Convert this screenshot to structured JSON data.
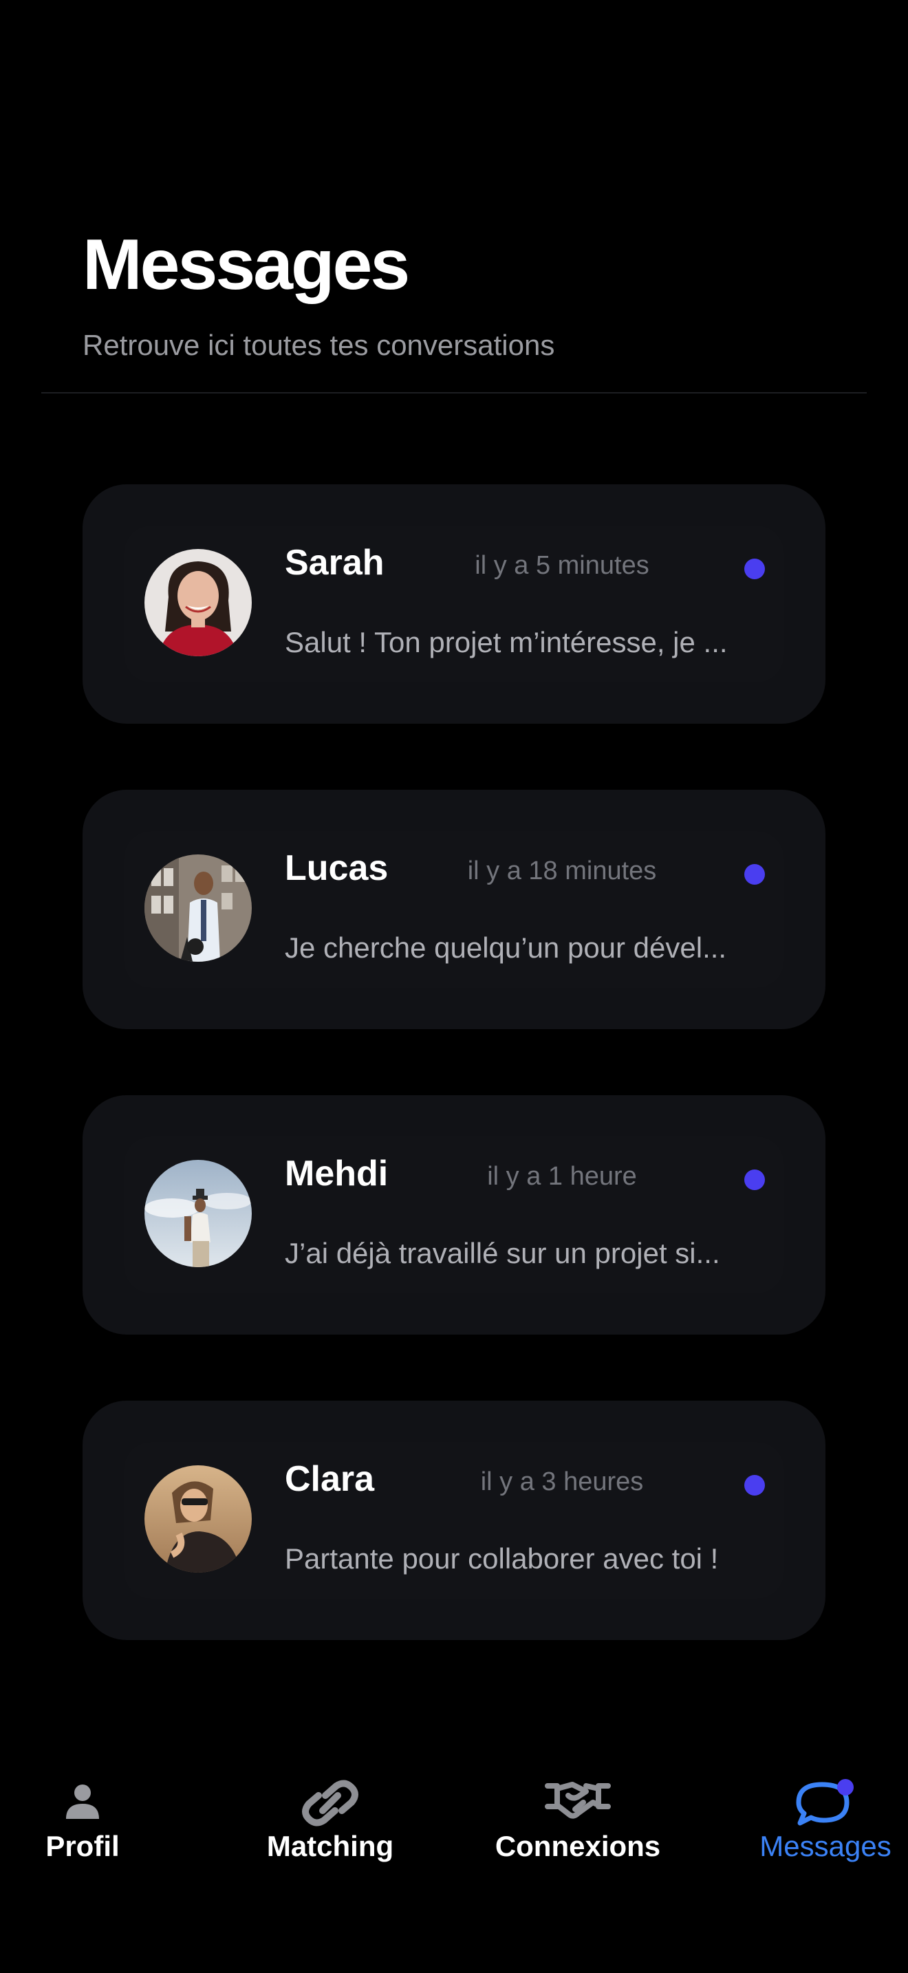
{
  "header": {
    "title": "Messages",
    "subtitle": "Retrouve ici toutes tes conversations"
  },
  "conversations": [
    {
      "name": "Sarah",
      "time": "il y a 5 minutes",
      "preview": "Salut ! Ton projet m’intéresse, je ...",
      "unread": true
    },
    {
      "name": "Lucas",
      "time": "il y a 18 minutes",
      "preview": "Je cherche quelqu’un pour dével...",
      "unread": true
    },
    {
      "name": "Mehdi",
      "time": "il y a 1 heure",
      "preview": "J’ai déjà travaillé sur un projet si...",
      "unread": true
    },
    {
      "name": "Clara",
      "time": "il y a 3 heures",
      "preview": "Partante pour collaborer avec toi !",
      "unread": true
    }
  ],
  "tabbar": {
    "tabs": [
      {
        "label": "Profil",
        "icon": "person-icon",
        "active": false
      },
      {
        "label": "Matching",
        "icon": "link-icon",
        "active": false
      },
      {
        "label": "Connexions",
        "icon": "handshake-icon",
        "active": false
      },
      {
        "label": "Messages",
        "icon": "chat-bubble-icon",
        "active": true
      }
    ]
  },
  "colors": {
    "background": "#000000",
    "card": "#111216",
    "unread_dot": "#4a3ef0",
    "active_tab": "#3b82f6",
    "subtitle": "#9b9ca1",
    "time": "#73757c"
  }
}
